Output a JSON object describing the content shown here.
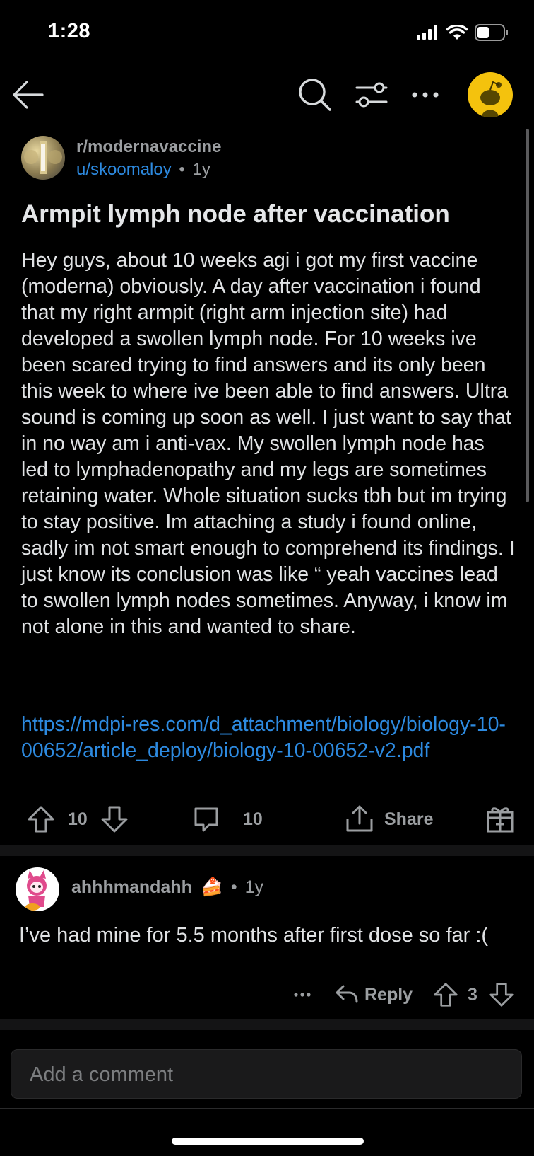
{
  "status_bar": {
    "time": "1:28"
  },
  "nav": {
    "icons": [
      "back-arrow-icon",
      "search-icon",
      "sort-filter-icon",
      "more-options-icon",
      "user-avatar"
    ]
  },
  "post": {
    "subreddit": "r/modernavaccine",
    "author": "u/skoomaloy",
    "age": "1y",
    "separator": "•",
    "title": "Armpit lymph node after vaccination",
    "body": "Hey guys, about 10 weeks agi i got my first vaccine (moderna) obviously. A day after vaccination i found that my right armpit (right arm injection site) had developed a swollen lymph node. For 10 weeks ive been scared trying to find answers and its only been this week to where ive been able to find answers. Ultra sound is coming up soon as well. I just want to say that in no way am i anti-vax. My swollen lymph node has led to lymphadenopathy and my legs are sometimes retaining water. Whole situation sucks tbh but im trying to stay positive. Im attaching a study i found online, sadly im not smart enough to comprehend its findings. I just know its conclusion was like “ yeah vaccines lead to swollen lymph nodes sometimes. Anyway, i know im not alone in this and wanted to share.",
    "link": "https://mdpi-res.com/d_attachment/biology/biology-10-00652/article_deploy/biology-10-00652-v2.pdf",
    "votes": "10",
    "comments": "10",
    "share_label": "Share"
  },
  "comment": {
    "author": "ahhhmandahh",
    "flair": "🍰",
    "separator": "•",
    "age": "1y",
    "body": "I’ve had mine for 5.5 months after first dose so far :(",
    "more": "···",
    "reply_label": "Reply",
    "votes": "3"
  },
  "comment_input": {
    "placeholder": "Add a comment"
  },
  "colors": {
    "background": "#000000",
    "link": "#2d8ae0",
    "muted": "#9b9ea1",
    "snoo_yellow": "#f4c20d"
  }
}
